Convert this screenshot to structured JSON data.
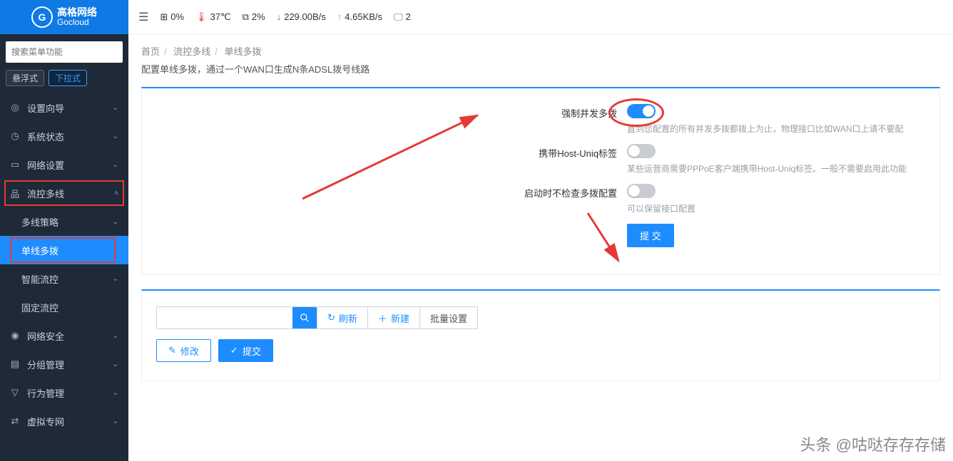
{
  "brand": {
    "cn": "高格网络",
    "en": "Gocloud",
    "glyph": "G"
  },
  "search": {
    "placeholder": "搜索菜单功能"
  },
  "modes": {
    "float": "悬浮式",
    "dropdown": "下拉式"
  },
  "nav": {
    "items": [
      {
        "icon": "◎",
        "label": "设置向导"
      },
      {
        "icon": "◷",
        "label": "系统状态"
      },
      {
        "icon": "▭",
        "label": "网络设置"
      },
      {
        "icon": "品",
        "label": "流控多线",
        "expanded": true
      },
      {
        "icon": "◉",
        "label": "网络安全"
      },
      {
        "icon": "▤",
        "label": "分组管理"
      },
      {
        "icon": "▽",
        "label": "行为管理"
      },
      {
        "icon": "⇄",
        "label": "虚拟专网"
      }
    ],
    "sub_flow": [
      {
        "label": "多线策略",
        "chev": true
      },
      {
        "label": "单线多拨",
        "active": true
      },
      {
        "label": "智能流控",
        "chev": true
      },
      {
        "label": "固定流控"
      }
    ]
  },
  "topbar": {
    "cpu": "0%",
    "temp": "37℃",
    "mem": "2%",
    "down": "229.00B/s",
    "up": "4.65KB/s",
    "clients": "2"
  },
  "breadcrumb": {
    "a": "首页",
    "b": "流控多线",
    "c": "单线多拨"
  },
  "page_desc": "配置单线多拨，通过一个WAN口生成N条ADSL拨号线路",
  "form": {
    "r1": {
      "label": "强制并发多拨",
      "hint": "直到您配置的所有并发多拨都拨上为止，物理接口比如WAN口上请不要配"
    },
    "r2": {
      "label": "携带Host-Uniq标签",
      "hint": "某些运营商需要PPPoE客户端携带Host-Uniq标签。一般不需要启用此功能"
    },
    "r3": {
      "label": "启动时不检查多拨配置",
      "hint": "可以保留接口配置"
    },
    "submit": "提 交"
  },
  "toolbar": {
    "refresh": "刷新",
    "new": "新建",
    "batch": "批量设置"
  },
  "actions": {
    "edit": "修改",
    "submit": "提交"
  },
  "watermark": "头条 @咕哒存存存储"
}
